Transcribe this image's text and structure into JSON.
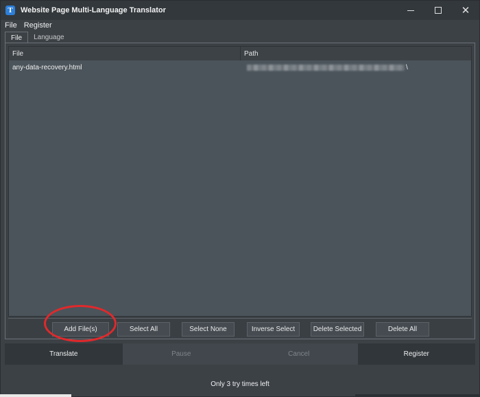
{
  "window": {
    "title": "Website Page Multi-Language Translator",
    "icon_letter": "T",
    "controls": [
      "minimize-icon",
      "maximize-icon",
      "close-icon"
    ],
    "close_glyph": "✕"
  },
  "menu": {
    "items": [
      {
        "label": "File"
      },
      {
        "label": "Register"
      }
    ]
  },
  "tabs": [
    {
      "label": "File",
      "active": true
    },
    {
      "label": "Language",
      "active": false
    }
  ],
  "file_list": {
    "columns": {
      "file": "File",
      "path": "Path"
    },
    "rows": [
      {
        "file": "any-data-recovery.html",
        "path_suffix": "\\"
      }
    ]
  },
  "actions": {
    "add_files": "Add File(s)",
    "select_all": "Select All",
    "select_none": "Select None",
    "inverse_select": "Inverse Select",
    "delete_selected": "Delete Selected",
    "delete_all": "Delete All"
  },
  "bottom": {
    "translate": "Translate",
    "pause": "Pause",
    "cancel": "Cancel",
    "register": "Register"
  },
  "status": "Only 3 try times left",
  "colors": {
    "background": "#3c4146",
    "list_background": "#4b545b",
    "highlight_ring": "#e0292b",
    "app_icon": "#2d7fd8"
  }
}
